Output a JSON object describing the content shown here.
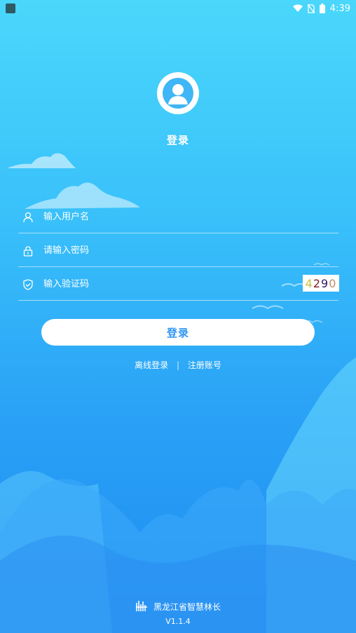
{
  "status_bar": {
    "time": "4:39"
  },
  "login": {
    "title": "登录",
    "username_placeholder": "输入用户名",
    "password_placeholder": "请输入密码",
    "captcha_placeholder": "输入验证码",
    "captcha_digits": [
      {
        "char": "4",
        "color": "#c9c23a"
      },
      {
        "char": "2",
        "color": "#7a1d2a"
      },
      {
        "char": "9",
        "color": "#2b1a6e"
      },
      {
        "char": "0",
        "color": "#c48a6a"
      }
    ],
    "submit_label": "登录",
    "offline_login": "离线登录",
    "separator": "|",
    "register": "注册账号"
  },
  "footer": {
    "app_name": "黑龙江省智慧林长",
    "version": "V1.1.4"
  },
  "colors": {
    "accent": "#2f97f3",
    "bg_top": "#4ad7fb",
    "bg_bottom": "#1f8cf2"
  }
}
